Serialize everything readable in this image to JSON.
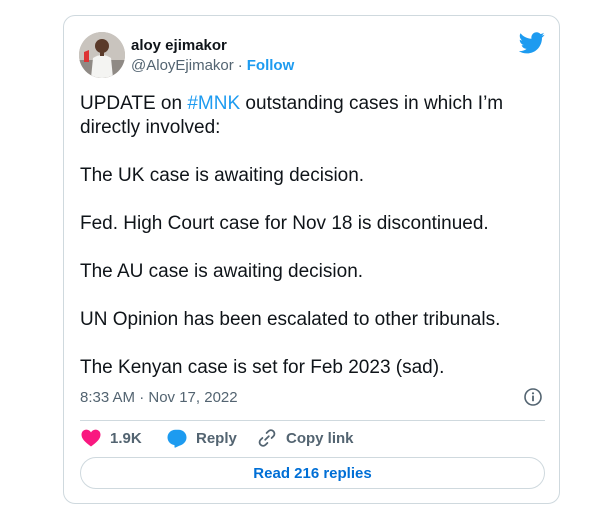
{
  "author": {
    "name": "aloy ejimakor",
    "handle": "@AloyEjimakor",
    "separator": "·",
    "follow_label": "Follow",
    "avatar_icon": "profile-photo"
  },
  "brand": {
    "logo_icon": "twitter-bird-icon",
    "color": "#1d9bf0"
  },
  "tweet": {
    "line1_prefix": "UPDATE on ",
    "line1_hashtag": "#MNK",
    "line1_suffix": " outstanding cases in which I’m directly involved:",
    "paragraphs": [
      "The UK case is awaiting decision.",
      "Fed. High Court case for Nov 18 is discontinued.",
      "The AU case is awaiting decision.",
      "UN Opinion has been escalated to other tribunals.",
      "The Kenyan case is set for Feb 2023 (sad)."
    ]
  },
  "meta": {
    "timestamp": "8:33 AM · Nov 17, 2022",
    "info_icon": "info-icon"
  },
  "actions": {
    "like_count": "1.9K",
    "reply_label": "Reply",
    "copy_label": "Copy link"
  },
  "replies_button_label": "Read 216 replies",
  "colors": {
    "accent": "#1d9bf0",
    "like": "#f91880",
    "text": "#0f1419",
    "secondary": "#536471",
    "border": "#cfd9de"
  }
}
